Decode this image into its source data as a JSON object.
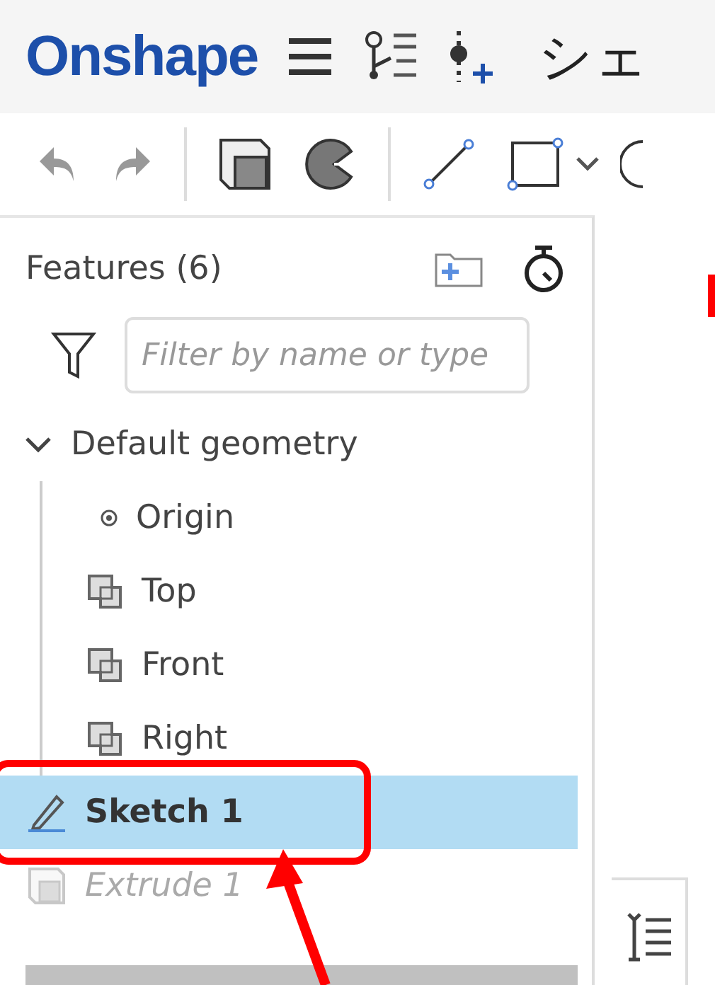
{
  "header": {
    "logo": "Onshape",
    "title": "シェ"
  },
  "panel": {
    "title": "Features (6)",
    "filter": {
      "placeholder": "Filter by name or type"
    },
    "tree": [
      {
        "label": "Default geometry",
        "kind": "group",
        "expanded": true,
        "selected": false,
        "disabled": false,
        "children": [
          {
            "label": "Origin",
            "kind": "origin",
            "selected": false,
            "disabled": false
          },
          {
            "label": "Top",
            "kind": "plane",
            "selected": false,
            "disabled": false
          },
          {
            "label": "Front",
            "kind": "plane",
            "selected": false,
            "disabled": false
          },
          {
            "label": "Right",
            "kind": "plane",
            "selected": false,
            "disabled": false
          }
        ]
      },
      {
        "label": "Sketch 1",
        "kind": "sketch",
        "selected": true,
        "disabled": false
      },
      {
        "label": "Extrude 1",
        "kind": "extrude",
        "selected": false,
        "disabled": true
      }
    ]
  }
}
